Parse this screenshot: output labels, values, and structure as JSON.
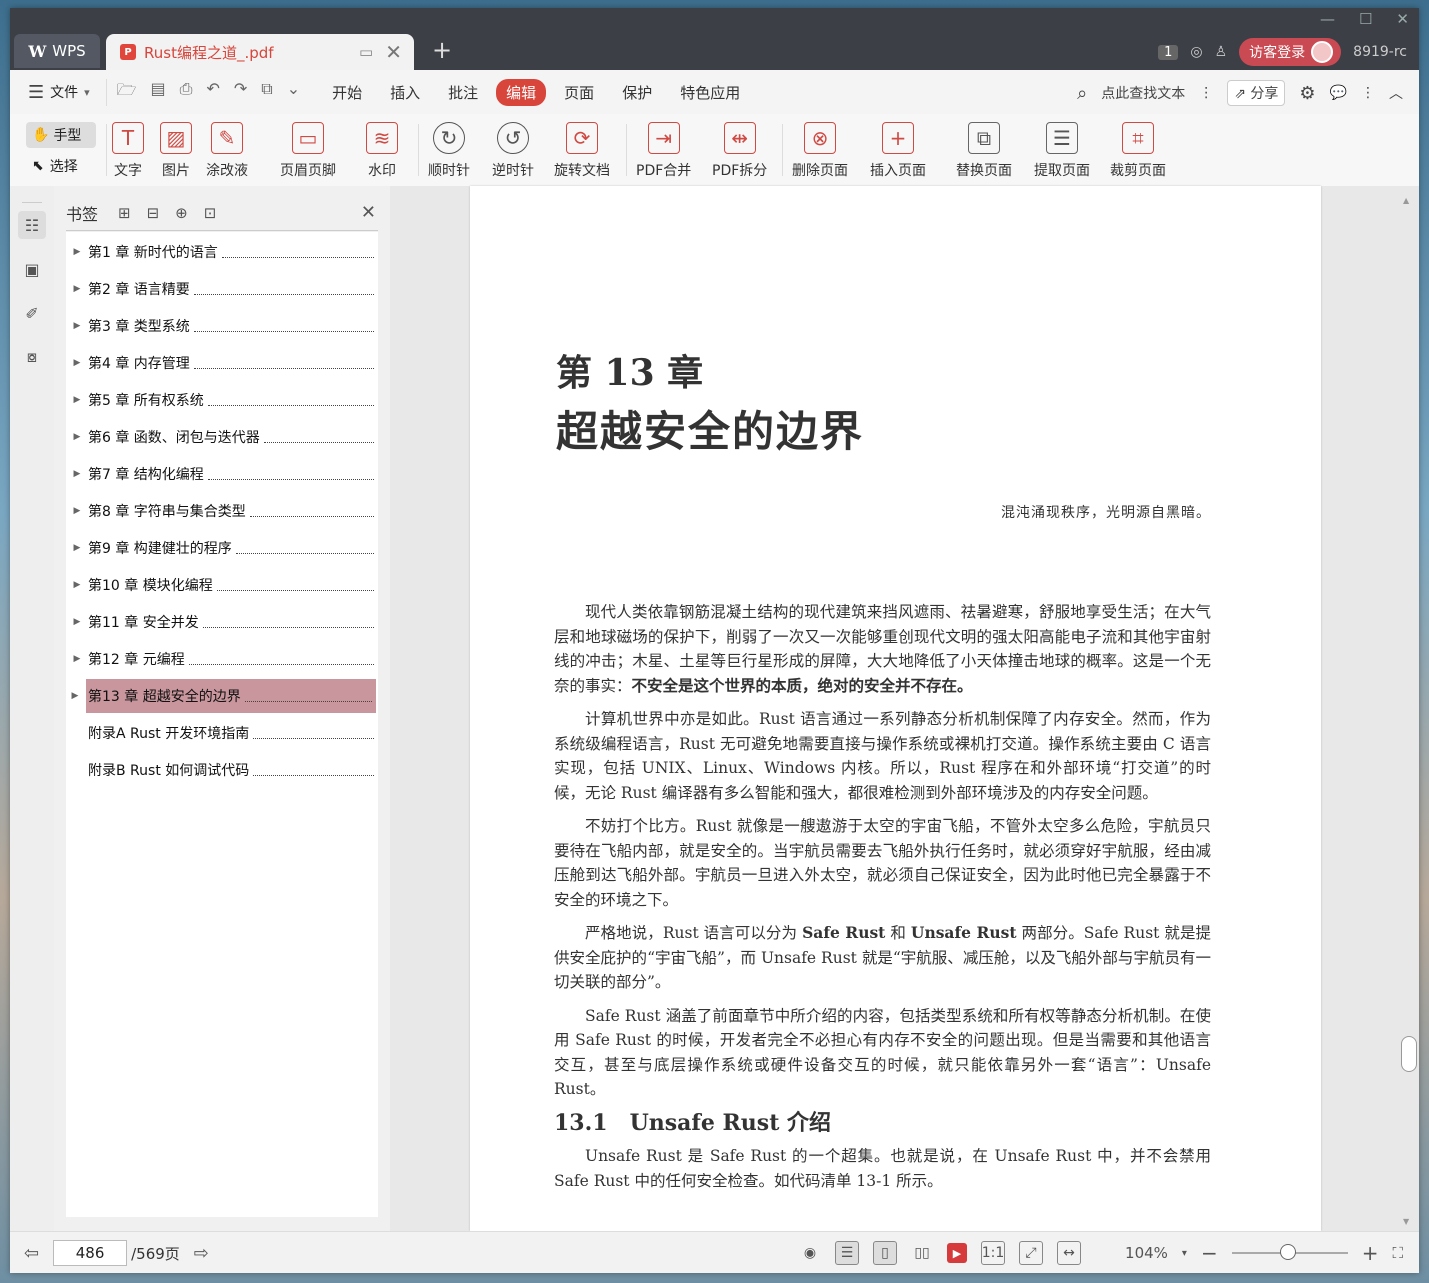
{
  "tabbar": {
    "app_tab": "WPS",
    "doc_tab": "Rust编程之道_.pdf",
    "login": "访客登录",
    "badge": "1",
    "user": "8919-rc"
  },
  "menubar": {
    "file": "文件",
    "tabs": [
      "开始",
      "插入",
      "批注",
      "编辑",
      "页面",
      "保护",
      "特色应用"
    ],
    "search": "点此查找文本",
    "share": "分享"
  },
  "ribbon": {
    "hand": "手型",
    "select": "选择",
    "tools": [
      "文字",
      "图片",
      "涂改液",
      "页眉页脚",
      "水印",
      "顺时针",
      "逆时针",
      "旋转文档",
      "PDF合并",
      "PDF拆分",
      "删除页面",
      "插入页面",
      "替换页面",
      "提取页面",
      "裁剪页面"
    ]
  },
  "bookmarks": {
    "title": "书签",
    "items": [
      "第1 章 新时代的语言",
      "第2 章 语言精要",
      "第3 章 类型系统",
      "第4 章 内存管理",
      "第5 章 所有权系统",
      "第6 章 函数、闭包与迭代器",
      "第7 章 结构化编程",
      "第8 章 字符串与集合类型",
      "第9 章 构建健壮的程序",
      "第10 章 模块化编程",
      "第11 章 安全并发",
      "第12 章 元编程",
      "第13 章 超越安全的边界",
      "附录A Rust 开发环境指南",
      "附录B Rust 如何调试代码"
    ]
  },
  "page": {
    "chapter_num": "第 13 章",
    "chapter_title": "超越安全的边界",
    "epigraph": "混沌涌现秩序，光明源自黑暗。",
    "p1a": "现代人类依靠钢筋混凝土结构的现代建筑来挡风遮雨、祛暑避寒，舒服地享受生活；在大气层和地球磁场的保护下，削弱了一次又一次能够重创现代文明的强太阳高能电子流和其他宇宙射线的冲击；木星、土星等巨行星形成的屏障，大大地降低了小天体撞击地球的概率。这是一个无奈的事实：",
    "p1b": "不安全是这个世界的本质，绝对的安全并不存在。",
    "p2": "计算机世界中亦是如此。Rust 语言通过一系列静态分析机制保障了内存安全。然而，作为系统级编程语言，Rust 无可避免地需要直接与操作系统或裸机打交道。操作系统主要由 C 语言实现，包括 UNIX、Linux、Windows 内核。所以，Rust 程序在和外部环境“打交道”的时候，无论 Rust 编译器有多么智能和强大，都很难检测到外部环境涉及的内存安全问题。",
    "p3": "不妨打个比方。Rust 就像是一艘遨游于太空的宇宙飞船，不管外太空多么危险，宇航员只要待在飞船内部，就是安全的。当宇航员需要去飞船外执行任务时，就必须穿好宇航服，经由减压舱到达飞船外部。宇航员一旦进入外太空，就必须自己保证安全，因为此时他已完全暴露于不安全的环境之下。",
    "p4a": "严格地说，Rust 语言可以分为 ",
    "p4b": "Safe Rust",
    "p4c": " 和 ",
    "p4d": "Unsafe Rust",
    "p4e": " 两部分。Safe Rust 就是提供安全庇护的“宇宙飞船”，而 Unsafe Rust 就是“宇航服、减压舱，以及飞船外部与宇航员有一切关联的部分”。",
    "p5": "Safe Rust 涵盖了前面章节中所介绍的内容，包括类型系统和所有权等静态分析机制。在使用 Safe Rust 的时候，开发者完全不必担心有内存不安全的问题出现。但是当需要和其他语言交互，甚至与底层操作系统或硬件设备交互的时候，就只能依靠另外一套“语言”：Unsafe Rust。",
    "section": "13.1　Unsafe Rust 介绍",
    "p6": "Unsafe Rust 是 Safe Rust 的一个超集。也就是说，在 Unsafe Rust 中，并不会禁用 Safe Rust 中的任何安全检查。如代码清单 13-1 所示。"
  },
  "status": {
    "current_page": "486",
    "total_pages": "/569页",
    "zoom": "104%"
  },
  "colors": {
    "accent": "#d8453b",
    "selected_bookmark": "#c8969c",
    "tabbar": "#3c3f46"
  }
}
